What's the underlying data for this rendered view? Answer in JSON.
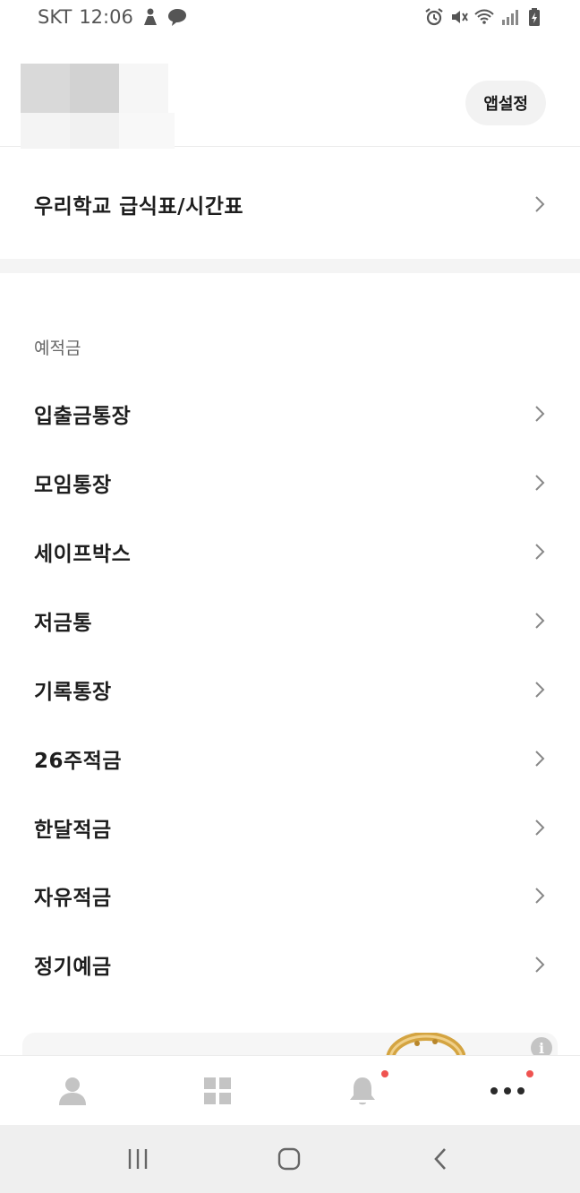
{
  "status_bar": {
    "carrier": "SKT",
    "time": "12:06",
    "left_icons": [
      "person-notification-icon",
      "chat-bubble-icon"
    ],
    "right_icons": [
      "alarm-icon",
      "mute-icon",
      "wifi-icon",
      "signal-icon",
      "battery-charging-icon"
    ]
  },
  "header": {
    "avatar": "blurred-profile-image",
    "app_settings_label": "앱설정"
  },
  "top_item": {
    "label": "우리학교 급식표/시간표"
  },
  "savings_section": {
    "title": "예적금",
    "items": [
      {
        "label": "입출금통장"
      },
      {
        "label": "모임통장"
      },
      {
        "label": "세이프박스"
      },
      {
        "label": "저금통"
      },
      {
        "label": "기록통장"
      },
      {
        "label": "26주적금"
      },
      {
        "label": "한달적금"
      },
      {
        "label": "자유적금"
      },
      {
        "label": "정기예금"
      }
    ]
  },
  "ad_card": {
    "image": "gold-ring-image",
    "info_icon": "info-icon",
    "info_glyph": "i"
  },
  "tab_bar": {
    "tabs": [
      {
        "icon": "person-icon",
        "badge": false
      },
      {
        "icon": "grid-icon",
        "badge": false
      },
      {
        "icon": "bell-icon",
        "badge": true
      },
      {
        "icon": "more-dots-icon",
        "badge": true
      }
    ],
    "badge_color": "#ef5350"
  },
  "nav_bar": {
    "buttons": [
      "recent-apps-icon",
      "home-icon",
      "back-icon"
    ]
  }
}
